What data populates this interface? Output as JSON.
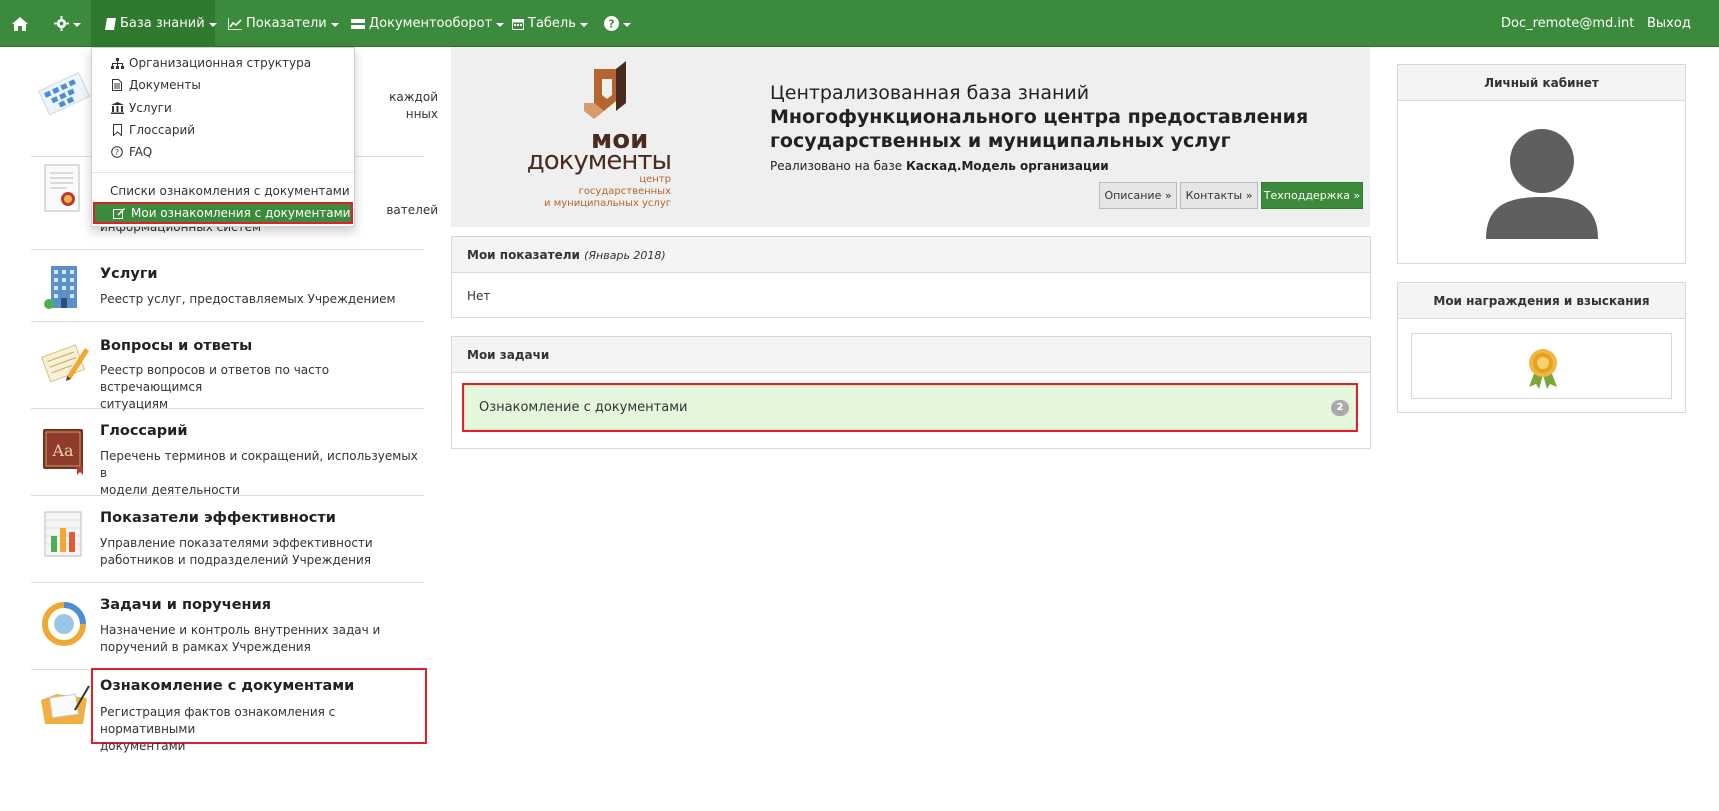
{
  "navbar": {
    "home_icon": "home-icon",
    "settings_icon": "gear-icon",
    "items": [
      {
        "label": "База знаний",
        "icon": "book-icon"
      },
      {
        "label": "Показатели",
        "icon": "chart-icon"
      },
      {
        "label": "Документооборот",
        "icon": "hdd-icon"
      },
      {
        "label": "Табель",
        "icon": "calendar-icon"
      }
    ],
    "help_icon": "question-icon",
    "user": "Doc_remote@md.int",
    "logout": "Выход"
  },
  "dropdown": {
    "items": [
      {
        "label": "Организационная структура",
        "icon": "sitemap-icon"
      },
      {
        "label": "Документы",
        "icon": "file-icon"
      },
      {
        "label": "Услуги",
        "icon": "bank-icon"
      },
      {
        "label": "Глоссарий",
        "icon": "bookmark-icon"
      },
      {
        "label": "FAQ",
        "icon": "question-circle-icon"
      }
    ],
    "lists_label": "Списки ознакомления с документами",
    "active_label": "Мои ознакомления с документами"
  },
  "left": {
    "items": [
      {
        "title": "",
        "desc_lines": [
          "каждой",
          "нных"
        ]
      },
      {
        "title": "",
        "desc_lines": [
          "вателей",
          "информационных систем"
        ]
      },
      {
        "title": "Услуги",
        "desc_lines": [
          "Реестр услуг, предоставляемых Учреждением"
        ]
      },
      {
        "title": "Вопросы и ответы",
        "desc_lines": [
          "Реестр вопросов и ответов по часто встречающимся",
          "ситуациям"
        ]
      },
      {
        "title": "Глоссарий",
        "desc_lines": [
          "Перечень терминов и сокращений, используемых в",
          "модели деятельности"
        ]
      },
      {
        "title": "Показатели эффективности",
        "desc_lines": [
          "Управление показателями эффективности",
          "работников и подразделений Учреждения"
        ]
      },
      {
        "title": "Задачи и поручения",
        "desc_lines": [
          "Назначение и контроль внутренних задач и",
          "поручений в рамках Учреждения"
        ]
      },
      {
        "title": "Ознакомление с документами",
        "desc_lines": [
          "Регистрация фактов ознакомления с нормативными",
          "документами"
        ]
      }
    ]
  },
  "banner": {
    "logo_line1": "мои",
    "logo_line2": "документы",
    "logo_sub1": "центр",
    "logo_sub2": "государственных",
    "logo_sub3": "и муниципальных услуг",
    "title": "Централизованная база знаний",
    "subtitle_line1": "Многофункционального центра предоставления",
    "subtitle_line2": "государственных и муниципальных услуг",
    "impl_prefix": "Реализовано на базе",
    "impl_bold": "Каскад.Модель организации",
    "btn_description": "Описание »",
    "btn_contacts": "Контакты »",
    "btn_support": "Техподдержка »"
  },
  "indicators": {
    "title": "Мои показатели",
    "period": "(Январь 2018)",
    "value": "Нет"
  },
  "tasks": {
    "title": "Мои задачи",
    "item_label": "Ознакомление с документами",
    "item_count": "2"
  },
  "cabinet": {
    "title": "Личный кабинет",
    "avatar_icon": "user-silhouette-icon"
  },
  "awards": {
    "title": "Мои награждения и взыскания",
    "icon": "award-medal-icon"
  },
  "colors": {
    "brand_green": "#3c8b3c",
    "highlight_red": "#e0202c",
    "task_bg": "#e4f7dc",
    "logo_brown": "#4a2a21",
    "logo_orange": "#b5652e"
  }
}
